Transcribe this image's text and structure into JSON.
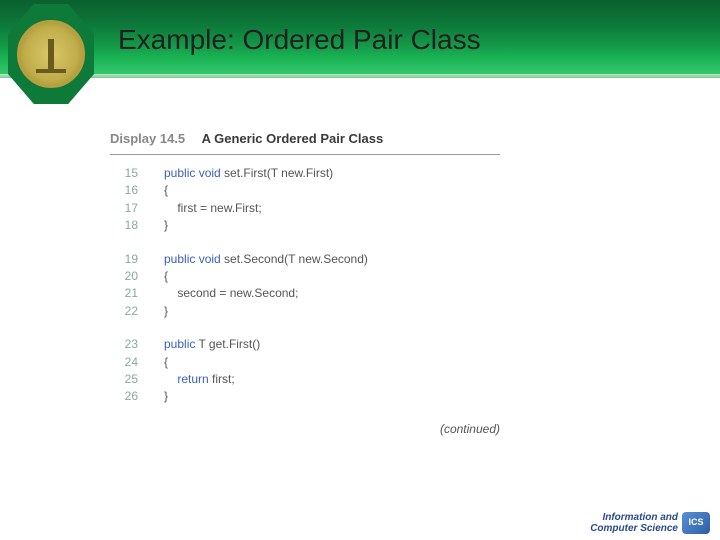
{
  "header": {
    "title": "Example: Ordered Pair Class"
  },
  "display": {
    "label": "Display 14.5",
    "title": "A Generic Ordered Pair Class"
  },
  "code": {
    "groups": [
      {
        "lines": [
          {
            "n": "15",
            "indent": "",
            "kw": "public void",
            "rest": " set.First(T new.First)"
          },
          {
            "n": "16",
            "indent": "",
            "kw": "",
            "rest": "{"
          },
          {
            "n": "17",
            "indent": "    ",
            "kw": "",
            "rest": "first = new.First;"
          },
          {
            "n": "18",
            "indent": "",
            "kw": "",
            "rest": "}"
          }
        ]
      },
      {
        "lines": [
          {
            "n": "19",
            "indent": "",
            "kw": "public void",
            "rest": " set.Second(T new.Second)"
          },
          {
            "n": "20",
            "indent": "",
            "kw": "",
            "rest": "{"
          },
          {
            "n": "21",
            "indent": "    ",
            "kw": "",
            "rest": "second = new.Second;"
          },
          {
            "n": "22",
            "indent": "",
            "kw": "",
            "rest": "}"
          }
        ]
      },
      {
        "lines": [
          {
            "n": "23",
            "indent": "",
            "kw": "public",
            "rest": " T get.First()"
          },
          {
            "n": "24",
            "indent": "",
            "kw": "",
            "rest": "{"
          },
          {
            "n": "25",
            "indent": "    ",
            "kw": "return",
            "rest": " first;"
          },
          {
            "n": "26",
            "indent": "",
            "kw": "",
            "rest": "}"
          }
        ]
      }
    ],
    "continued": "(continued)"
  },
  "footer": {
    "line1": "Information and",
    "line2": "Computer Science",
    "badge": "ICS"
  }
}
